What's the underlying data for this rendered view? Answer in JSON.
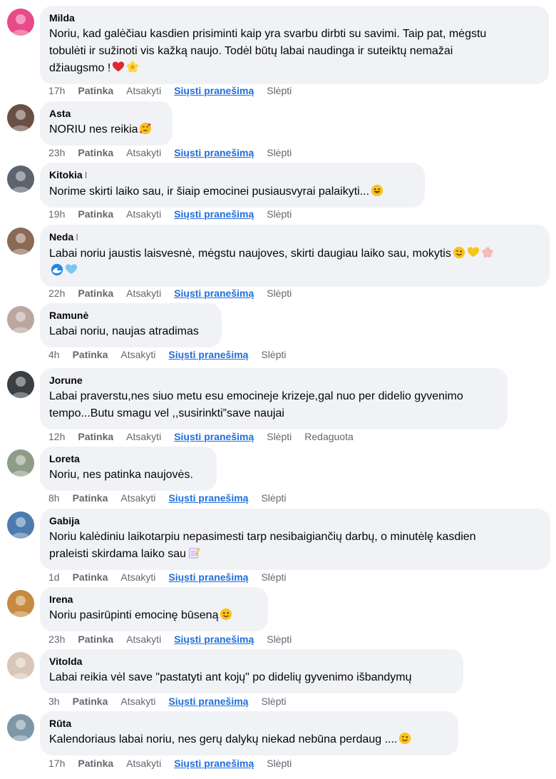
{
  "actions": {
    "like": "Patinka",
    "reply": "Atsakyti",
    "send_message": "Siųsti pranešimą",
    "hide": "Slėpti",
    "edited": "Redaguota"
  },
  "comments": [
    {
      "name": "Milda",
      "name_suffix": "",
      "lines": [
        "Noriu, kad galėčiau kasdien prisiminti kaip yra svarbu dirbti su savimi. Taip pat, mėgstu",
        "tobulėti ir sužinoti vis kažką naujo. Todėl būtų labai naudinga ir suteiktų nemažai",
        "džiaugsmo !"
      ],
      "emojis": [
        "heart",
        "blossom"
      ],
      "time": "17h",
      "edited": false,
      "avatar_color": "#e84a8a"
    },
    {
      "name": "Asta",
      "name_suffix": "",
      "lines": [
        "NORIU nes reikia"
      ],
      "emojis": [
        "hearts-face"
      ],
      "time": "23h",
      "edited": false,
      "avatar_color": "#6b4f45"
    },
    {
      "name": "Kitokia",
      "name_suffix": "I",
      "lines": [
        "Norime skirti laiko sau, ir šiaip emocinei pusiausvyrai palaikyti..."
      ],
      "emojis": [
        "grin"
      ],
      "time": "19h",
      "edited": false,
      "avatar_color": "#5c6470"
    },
    {
      "name": "Neda",
      "name_suffix": "I",
      "lines": [
        "Labai noriu jaustis laisvesnė, mėgstu naujoves, skirti daugiau laiko sau, mokytis",
        ""
      ],
      "emojis": [
        "wink",
        "yellow-heart",
        "flower",
        "wave",
        "blue-heart"
      ],
      "time": "22h",
      "edited": false,
      "avatar_color": "#8a6a55"
    },
    {
      "name": "Ramunė",
      "name_suffix": "",
      "lines": [
        "Labai noriu, naujas atradimas"
      ],
      "emojis": [],
      "time": "4h",
      "edited": false,
      "avatar_color": "#b9a7a0"
    },
    {
      "name": "Jorune",
      "name_suffix": "",
      "lines": [
        "Labai praverstu,nes siuo metu esu emocineje krizeje,gal nuo per didelio gyvenimo",
        "tempo...Butu smagu vel ,,susirinkti”save naujai"
      ],
      "emojis": [],
      "time": "12h",
      "edited": true,
      "avatar_color": "#3a3f44"
    },
    {
      "name": "Loreta",
      "name_suffix": "",
      "lines": [
        "Noriu, nes patinka naujovės."
      ],
      "emojis": [],
      "time": "8h",
      "edited": false,
      "avatar_color": "#8f9c87"
    },
    {
      "name": "Gabija",
      "name_suffix": "",
      "lines": [
        "Noriu kalėdiniu laikotarpiu nepasimesti tarp nesibaigiančių darbų, o minutėlę kasdien",
        "praleisti skirdama laiko sau"
      ],
      "emojis": [
        "memo"
      ],
      "time": "1d",
      "edited": false,
      "avatar_color": "#4c7bb0"
    },
    {
      "name": "Irena",
      "name_suffix": "",
      "lines": [
        "Noriu pasirūpinti emocinę būseną"
      ],
      "emojis": [
        "smile"
      ],
      "time": "23h",
      "edited": false,
      "avatar_color": "#c78a3e"
    },
    {
      "name": "Vitolda",
      "name_suffix": "",
      "lines": [
        "Labai reikia vėl save \"pastatyti ant kojų\" po didelių gyvenimo išbandymų"
      ],
      "emojis": [],
      "time": "3h",
      "edited": false,
      "avatar_color": "#d8c7b8"
    },
    {
      "name": "Rūta",
      "name_suffix": "",
      "lines": [
        "Kalendoriaus labai noriu, nes gerų dalykų niekad nebūna perdaug ...."
      ],
      "emojis": [
        "wink"
      ],
      "time": "17h",
      "edited": false,
      "avatar_color": "#7d96a8"
    }
  ]
}
